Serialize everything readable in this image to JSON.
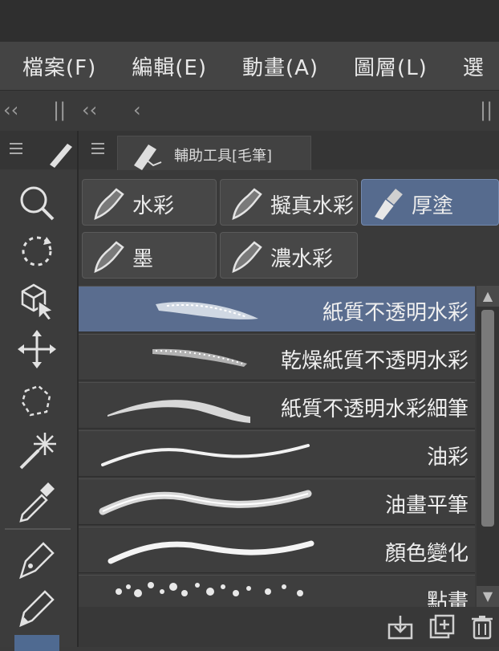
{
  "menu": {
    "items": [
      {
        "label": "檔案(F)"
      },
      {
        "label": "編輯(E)"
      },
      {
        "label": "動畫(A)"
      },
      {
        "label": "圖層(L)"
      },
      {
        "label": "選"
      }
    ]
  },
  "collapse_bar": {
    "left_chevrons": "‹‹",
    "left_bars": "||",
    "mid_chevrons": "‹‹",
    "single_chevron": "‹",
    "right_bars": "||"
  },
  "tool_panel": {
    "tools": [
      {
        "icon": "zoom-icon"
      },
      {
        "icon": "rotate-icon"
      },
      {
        "icon": "object-select-icon"
      },
      {
        "icon": "move-icon"
      },
      {
        "icon": "lasso-icon"
      },
      {
        "icon": "magic-wand-icon"
      },
      {
        "icon": "eyedropper-icon"
      },
      {
        "icon": "pen-icon"
      },
      {
        "icon": "pencil-icon"
      },
      {
        "icon": "brush-icon"
      }
    ]
  },
  "subtool_panel": {
    "title": "輔助工具[毛筆]",
    "groups": [
      {
        "label": "水彩",
        "selected": false
      },
      {
        "label": "擬真水彩",
        "selected": false
      },
      {
        "label": "厚塗",
        "selected": true
      },
      {
        "label": "墨",
        "selected": false
      },
      {
        "label": "濃水彩",
        "selected": false
      }
    ],
    "brushes": [
      {
        "name": "紙質不透明水彩",
        "selected": true
      },
      {
        "name": "乾燥紙質不透明水彩",
        "selected": false
      },
      {
        "name": "紙質不透明水彩細筆",
        "selected": false
      },
      {
        "name": "油彩",
        "selected": false
      },
      {
        "name": "油畫平筆",
        "selected": false
      },
      {
        "name": "顏色變化",
        "selected": false
      },
      {
        "name": "點畫",
        "selected": false
      }
    ]
  },
  "colors": {
    "accent": "#566b8e",
    "panel_bg": "#3a3a3a",
    "menu_bg": "#444444"
  }
}
